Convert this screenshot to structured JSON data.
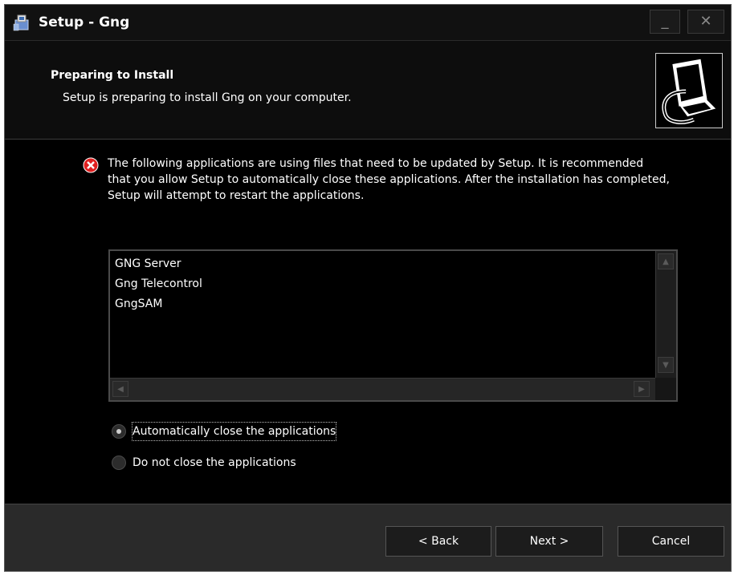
{
  "window": {
    "title": "Setup - Gng",
    "minimize_glyph": "_",
    "close_glyph": "✕"
  },
  "header": {
    "title": "Preparing to Install",
    "subtitle": "Setup is preparing to install Gng on your computer."
  },
  "content": {
    "message": "The following applications are using files that need to be updated by Setup. It is recommended that you allow Setup to automatically close these applications. After the installation has completed, Setup will attempt to restart the applications.",
    "applications": [
      "GNG Server",
      "Gng Telecontrol",
      "GngSAM"
    ],
    "options": [
      {
        "label": "Automatically close the applications",
        "selected": true
      },
      {
        "label": "Do not close the applications",
        "selected": false
      }
    ]
  },
  "buttons": {
    "back": "< Back",
    "next": "Next >",
    "cancel": "Cancel"
  },
  "icons": {
    "app": "setup-installer-icon",
    "error": "error-icon",
    "header_image": "computer-install-icon"
  },
  "colors": {
    "background": "#000000",
    "error_red": "#e02020",
    "text": "#ffffff"
  }
}
